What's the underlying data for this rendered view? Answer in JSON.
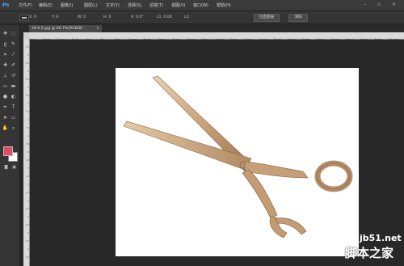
{
  "app": {
    "logo": "Ps"
  },
  "menu": [
    {
      "id": "file",
      "label": "文件(F)"
    },
    {
      "id": "edit",
      "label": "编辑(E)"
    },
    {
      "id": "image",
      "label": "图像(I)"
    },
    {
      "id": "layer",
      "label": "图层(L)"
    },
    {
      "id": "type",
      "label": "文字(Y)"
    },
    {
      "id": "select",
      "label": "选择(S)"
    },
    {
      "id": "filter",
      "label": "滤镜(T)"
    },
    {
      "id": "view",
      "label": "视图(V)"
    },
    {
      "id": "window",
      "label": "窗口(W)"
    },
    {
      "id": "help",
      "label": "帮助(H)"
    }
  ],
  "window_controls": "– ▫ ×",
  "options": {
    "tool_icon": "ruler-icon",
    "x": "X: 0",
    "y": "Y: 0",
    "w": "W: 0",
    "h": "H: 0",
    "a": "A: 0.0°",
    "l1": "L1: 0.00",
    "l2": "L2:",
    "straighten_label": "拉直图层",
    "clear_label": "清除"
  },
  "document": {
    "tab_title": "18.9.5.jpg @ 66.7%(RGB/8)",
    "close_glyph": "×"
  },
  "ruler_ticks": [
    "250",
    "200",
    "150",
    "100",
    "50",
    "0",
    "50",
    "100",
    "150",
    "200",
    "250",
    "300",
    "350",
    "400",
    "450",
    "500",
    "550",
    "600",
    "650",
    "700",
    "750",
    "800",
    "850",
    "900",
    "950",
    "1000"
  ],
  "tools": [
    {
      "name": "move-tool-icon",
      "glyph": "✥"
    },
    {
      "name": "marquee-tool-icon",
      "glyph": "◌"
    },
    {
      "name": "lasso-tool-icon",
      "glyph": "ϱ"
    },
    {
      "name": "quick-select-tool-icon",
      "glyph": "✎"
    },
    {
      "name": "crop-tool-icon",
      "glyph": "⌗"
    },
    {
      "name": "eyedropper-tool-icon",
      "glyph": "⁄"
    },
    {
      "name": "spot-heal-tool-icon",
      "glyph": "✚"
    },
    {
      "name": "brush-tool-icon",
      "glyph": "✐"
    },
    {
      "name": "clone-stamp-tool-icon",
      "glyph": "⊥"
    },
    {
      "name": "history-brush-tool-icon",
      "glyph": "↺"
    },
    {
      "name": "eraser-tool-icon",
      "glyph": "▭"
    },
    {
      "name": "gradient-tool-icon",
      "glyph": "▬"
    },
    {
      "name": "blur-tool-icon",
      "glyph": "●"
    },
    {
      "name": "dodge-tool-icon",
      "glyph": "◐"
    },
    {
      "name": "pen-tool-icon",
      "glyph": "✒"
    },
    {
      "name": "type-tool-icon",
      "glyph": "T"
    },
    {
      "name": "path-select-tool-icon",
      "glyph": "➤"
    },
    {
      "name": "shape-tool-icon",
      "glyph": "▭"
    },
    {
      "name": "hand-tool-icon",
      "glyph": "✋"
    },
    {
      "name": "zoom-tool-icon",
      "glyph": "⌕"
    }
  ],
  "colors": {
    "foreground": "#e24a66",
    "background": "#ffffff"
  },
  "watermark": {
    "site": "jb51.net",
    "name": "脚本之家"
  }
}
